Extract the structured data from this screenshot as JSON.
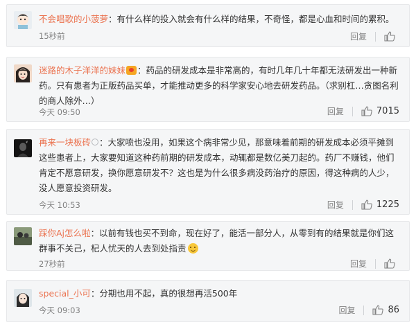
{
  "comments": [
    {
      "username": "不会唱歌的小菠萝",
      "text": "：有什么样的投入就会有什么样的结果，不奇怪，都是心血和时间的累积。",
      "time": "15秒前",
      "reply": "回复",
      "likes": ""
    },
    {
      "username": "迷路的木子洋洋的妹妹",
      "text": "：药品的研发成本是非常高的，有时几年几十年都无法研发出一种新药。只有患者为正版药品买单，才能推动更多的科学家安心地去研发药品。（求别杠…贪图名利的商人除外…）",
      "time": "今天 09:50",
      "reply": "回复",
      "likes": "7015"
    },
    {
      "username": "再来一块板砖",
      "text": "：大家喷也没用，如果这个病非常少见，那意味着前期的研发成本必须平摊到这些患者上，大家要知道这种药前期的研发成本，动辄都是数亿美刀起的。药厂不赚钱，他们肯定不愿意研发，换你愿意研发不？这也是为什么很多病没药治疗的原因，得这种病的人少，没人愿意投资研发。",
      "time": "今天 10:53",
      "reply": "回复",
      "likes": "1225"
    },
    {
      "username": "踩你Aj怎么啦",
      "text": "：以前有钱也买不到命，现在好了，能活一部分人，从零到有的结果就是你们这群事不关己，杞人忧天的人去到处指责",
      "time": "27秒前",
      "reply": "回复",
      "likes": ""
    },
    {
      "username": "special_小可",
      "text": "：分期也用不起，真的很想再活500年",
      "time": "今天 09:03",
      "reply": "回复",
      "likes": "86"
    }
  ],
  "colors": {
    "username": "#eb7350",
    "meta": "#808080",
    "card_bg": "#f5f6f7"
  }
}
